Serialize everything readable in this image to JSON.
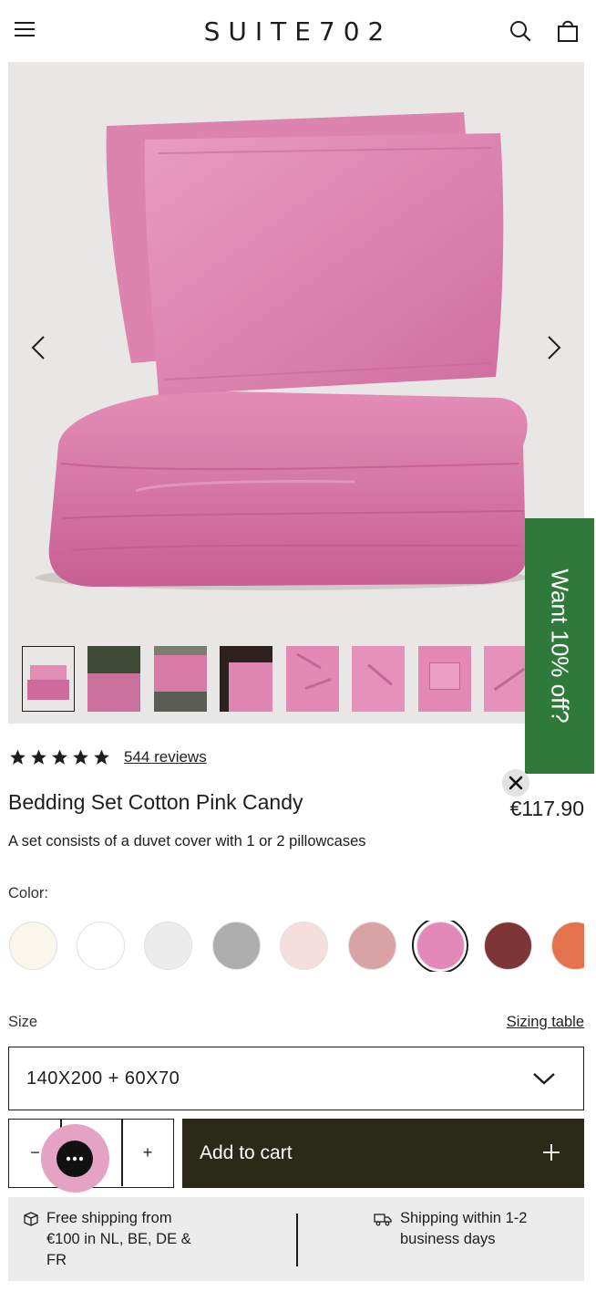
{
  "header": {
    "logo": "SUITE702",
    "menu_icon": "hamburger-menu-icon",
    "search_icon": "search-icon",
    "cart_icon": "shopping-bag-icon"
  },
  "gallery": {
    "prev_icon": "chevron-left-icon",
    "next_icon": "chevron-right-icon",
    "thumbnail_count": 9,
    "active_thumbnail": 1
  },
  "promo": {
    "text": "Want 10% off?",
    "color": "#2f7a3a",
    "close_icon": "close-icon"
  },
  "product": {
    "rating": 5,
    "reviews_text": "544 reviews",
    "title": "Bedding Set Cotton Pink Candy",
    "price": "€117.90",
    "description": "A set consists of a duvet cover with 1 or 2 pillowcases"
  },
  "color": {
    "label": "Color:",
    "swatches": [
      "#faf6ec",
      "#ffffff",
      "#ececec",
      "#adadad",
      "#f6dedf",
      "#d9a3a5",
      "#e388b9",
      "#7d3536",
      "#e4724d"
    ],
    "selected_index": 6
  },
  "size": {
    "label": "Size",
    "sizing_link": "Sizing table",
    "selected": "140X200 + 60X70",
    "dropdown_icon": "chevron-down-icon"
  },
  "cart": {
    "minus": "−",
    "plus": "+",
    "add_label": "Add to cart",
    "add_icon": "plus-icon",
    "button_color": "#2b2a19"
  },
  "chat": {
    "icon": "chat-dots-icon",
    "color": "#e4a3c2"
  },
  "shipping": {
    "free_icon": "box-icon",
    "free_text": "Free shipping from €100 in NL, BE, DE & FR",
    "free_line1": "Free shipping from",
    "free_line2": "€100 in NL, BE, DE &",
    "free_line3": "FR",
    "delivery_icon": "truck-icon",
    "delivery_line1": "Shipping within 1-2",
    "delivery_line2": "business days"
  }
}
